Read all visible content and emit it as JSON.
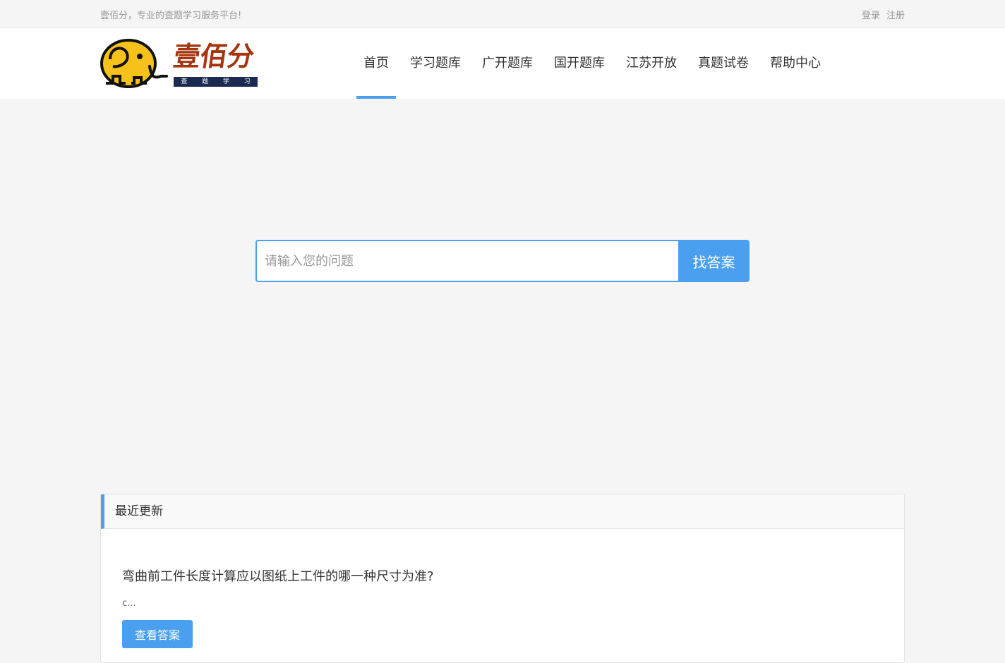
{
  "topbar": {
    "slogan": "壹佰分，专业的查题学习服务平台!",
    "login": "登录",
    "register": "注册"
  },
  "logo": {
    "name": "壹佰分",
    "tagline": [
      "查",
      "题",
      "学",
      "习"
    ],
    "colors": {
      "mascot": "#f6c11b",
      "wordmark": "#a5350f",
      "tagline_bg": "#1c2a52"
    }
  },
  "nav": {
    "items": [
      {
        "label": "首页",
        "active": true
      },
      {
        "label": "学习题库",
        "active": false
      },
      {
        "label": "广开题库",
        "active": false
      },
      {
        "label": "国开题库",
        "active": false
      },
      {
        "label": "江苏开放",
        "active": false
      },
      {
        "label": "真题试卷",
        "active": false
      },
      {
        "label": "帮助中心",
        "active": false
      }
    ]
  },
  "search": {
    "placeholder": "请输入您的问题",
    "value": "",
    "button": "找答案"
  },
  "recent": {
    "heading": "最近更新",
    "items": [
      {
        "title": "弯曲前工件长度计算应以图纸上工件的哪一种尺寸为准?",
        "excerpt": "c...",
        "button": "查看答案"
      }
    ]
  },
  "colors": {
    "accent": "#4a9fee",
    "background": "#f5f5f5"
  }
}
